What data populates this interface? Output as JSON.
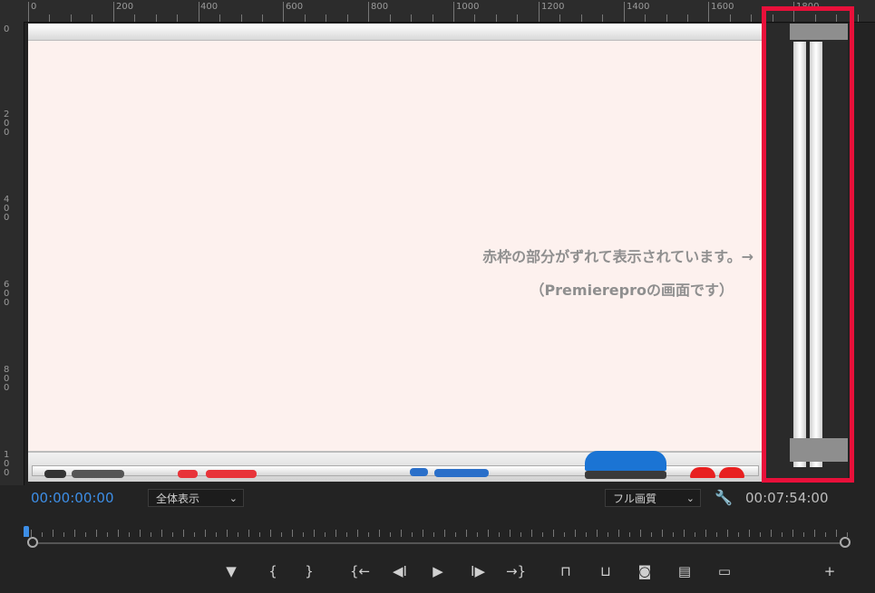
{
  "ruler": {
    "top_labels": [
      "0",
      "200",
      "400",
      "600",
      "800",
      "1000",
      "1200",
      "1400",
      "1600",
      "1800"
    ],
    "left_labels": [
      "0",
      "2\n0\n0",
      "4\n0\n0",
      "6\n0\n0",
      "8\n0\n0",
      "1\n0\n0"
    ]
  },
  "canvas": {
    "note_line1": "赤枠の部分がずれて表示されています。→",
    "note_line2": "（Premiereproの画面です）"
  },
  "monitor": {
    "current_time": "00:00:00:00",
    "zoom_select": "全体表示",
    "quality_select": "フル画質",
    "duration": "00:07:54:00"
  },
  "colors": {
    "accent": "#3d8ee6",
    "highlight_frame": "#e8103a",
    "canvas_bg": "#fdf1ee"
  },
  "transport": [
    {
      "name": "add-marker-button",
      "glyph": "▼"
    },
    {
      "name": "mark-in-button",
      "glyph": "{"
    },
    {
      "name": "mark-out-button",
      "glyph": "}"
    },
    {
      "name": "go-to-in-button",
      "glyph": "{←"
    },
    {
      "name": "step-back-button",
      "glyph": "◀I"
    },
    {
      "name": "play-button",
      "glyph": "▶"
    },
    {
      "name": "step-forward-button",
      "glyph": "I▶"
    },
    {
      "name": "go-to-out-button",
      "glyph": "→}"
    },
    {
      "name": "lift-button",
      "glyph": "⊓"
    },
    {
      "name": "extract-button",
      "glyph": "⊔"
    },
    {
      "name": "export-frame-button",
      "glyph": "◙"
    },
    {
      "name": "compare-view-button",
      "glyph": "▤"
    },
    {
      "name": "safe-margins-button",
      "glyph": "▭"
    },
    {
      "name": "button-editor-button",
      "glyph": "+"
    }
  ]
}
